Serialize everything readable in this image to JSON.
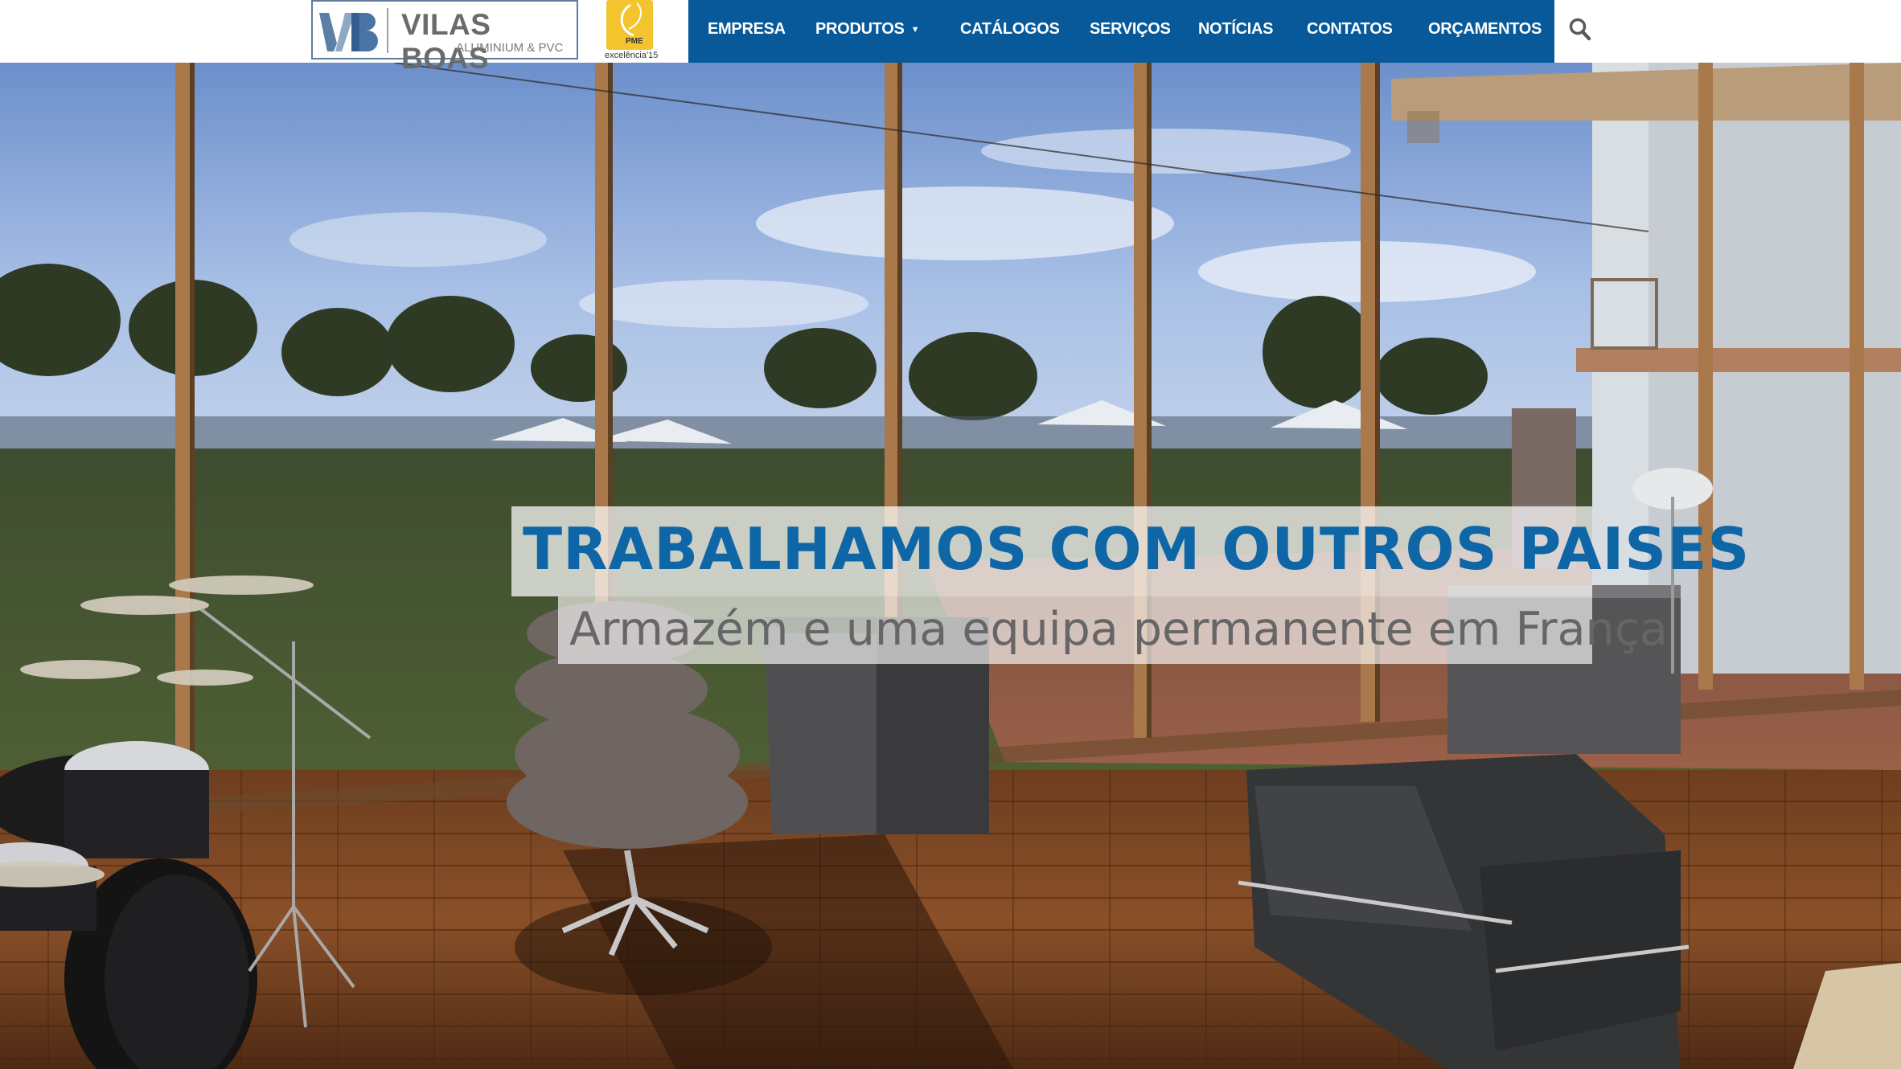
{
  "header": {
    "logo": {
      "name": "VILAS BOAS",
      "subtitle": "ALUMINIUM & PVC",
      "icon": "vb-logo-icon"
    },
    "badge": {
      "text": "PME",
      "label": "excelência'15",
      "icon": "pme-excelencia-icon"
    },
    "nav": [
      {
        "label": "EMPRESA"
      },
      {
        "label": "PRODUTOS",
        "has_dropdown": true
      },
      {
        "label": "CATÁLOGOS"
      },
      {
        "label": "SERVIÇOS"
      },
      {
        "label": "NOTÍCIAS"
      },
      {
        "label": "CONTATOS"
      },
      {
        "label": "ORÇAMENTOS"
      }
    ],
    "search_icon": "search-icon"
  },
  "hero": {
    "title": "TRABALHAMOS COM OUTROS PAISES",
    "subtitle": "Armazém e uma equipa permanente em França"
  },
  "colors": {
    "nav_bg": "#075999",
    "title_blue": "#0e66a7",
    "subtitle_gray": "#666666",
    "logo_border": "#5f7b9c",
    "badge_yellow": "#f3c42d"
  }
}
